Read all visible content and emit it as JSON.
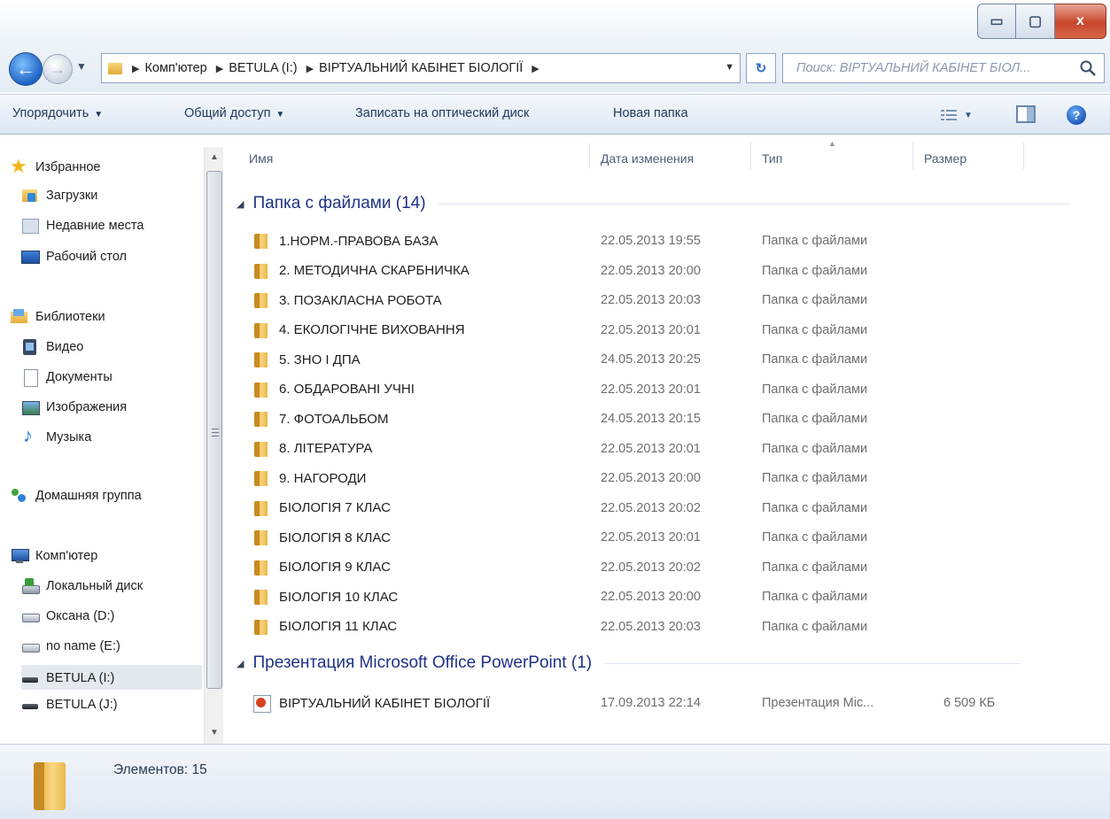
{
  "window": {
    "controls": {
      "minimize": "▭",
      "maximize": "▢",
      "close": "x"
    }
  },
  "address": {
    "path": [
      "Комп'ютер",
      "BETULA (I:)",
      "ВІРТУАЛЬНИЙ КАБІНЕТ БІОЛОГІЇ"
    ],
    "search_placeholder": "Поиск: ВІРТУАЛЬНИЙ КАБІНЕТ БІОЛ..."
  },
  "toolbar": {
    "organize": "Упорядочить",
    "share": "Общий доступ",
    "burn": "Записать на оптический диск",
    "new_folder": "Новая папка"
  },
  "nav": {
    "favorites": "Избранное",
    "downloads": "Загрузки",
    "recent": "Недавние места",
    "desktop": "Рабочий стол",
    "libraries": "Библиотеки",
    "video": "Видео",
    "documents": "Документы",
    "images": "Изображения",
    "music": "Музыка",
    "homegroup": "Домашняя группа",
    "computer": "Комп'ютер",
    "local_disk": "Локальный диск",
    "drive_d": "Оксана (D:)",
    "drive_e": "no name (E:)",
    "drive_i": "BETULA (I:)",
    "drive_j": "BETULA (J:)"
  },
  "columns": {
    "name": "Имя",
    "date": "Дата изменения",
    "type": "Тип",
    "size": "Размер"
  },
  "groups": {
    "folders": {
      "label": "Папка с файлами (14)",
      "items": [
        {
          "name": "1.НОРМ.-ПРАВОВА БАЗА",
          "date": "22.05.2013 19:55",
          "type": "Папка с файлами"
        },
        {
          "name": "2. МЕТОДИЧНА СКАРБНИЧКА",
          "date": "22.05.2013 20:00",
          "type": "Папка с файлами"
        },
        {
          "name": "3. ПОЗАКЛАСНА РОБОТА",
          "date": "22.05.2013 20:03",
          "type": "Папка с файлами"
        },
        {
          "name": "4. ЕКОЛОГІЧНЕ ВИХОВАННЯ",
          "date": "22.05.2013 20:01",
          "type": "Папка с файлами"
        },
        {
          "name": "5. ЗНО І ДПА",
          "date": "24.05.2013 20:25",
          "type": "Папка с файлами"
        },
        {
          "name": "6. ОБДАРОВАНІ УЧНІ",
          "date": "22.05.2013 20:01",
          "type": "Папка с файлами"
        },
        {
          "name": "7. ФОТОАЛЬБОМ",
          "date": "24.05.2013 20:15",
          "type": "Папка с файлами"
        },
        {
          "name": "8. ЛІТЕРАТУРА",
          "date": "22.05.2013 20:01",
          "type": "Папка с файлами"
        },
        {
          "name": "9. НАГОРОДИ",
          "date": "22.05.2013 20:00",
          "type": "Папка с файлами"
        },
        {
          "name": "БІОЛОГІЯ 7 КЛАС",
          "date": "22.05.2013 20:02",
          "type": "Папка с файлами"
        },
        {
          "name": "БІОЛОГІЯ 8 КЛАС",
          "date": "22.05.2013 20:01",
          "type": "Папка с файлами"
        },
        {
          "name": "БІОЛОГІЯ 9 КЛАС",
          "date": "22.05.2013 20:02",
          "type": "Папка с файлами"
        },
        {
          "name": "БІОЛОГІЯ 10 КЛАС",
          "date": "22.05.2013 20:00",
          "type": "Папка с файлами"
        },
        {
          "name": "БІОЛОГІЯ 11 КЛАС",
          "date": "22.05.2013 20:03",
          "type": "Папка с файлами"
        }
      ]
    },
    "presentations": {
      "label": "Презентация Microsoft Office PowerPoint (1)",
      "items": [
        {
          "name": "ВІРТУАЛЬНИЙ КАБІНЕТ БІОЛОГІЇ",
          "date": "17.09.2013 22:14",
          "type": "Презентация Mic...",
          "size": "6 509 КБ"
        }
      ]
    }
  },
  "status": {
    "text": "Элементов: 15"
  }
}
